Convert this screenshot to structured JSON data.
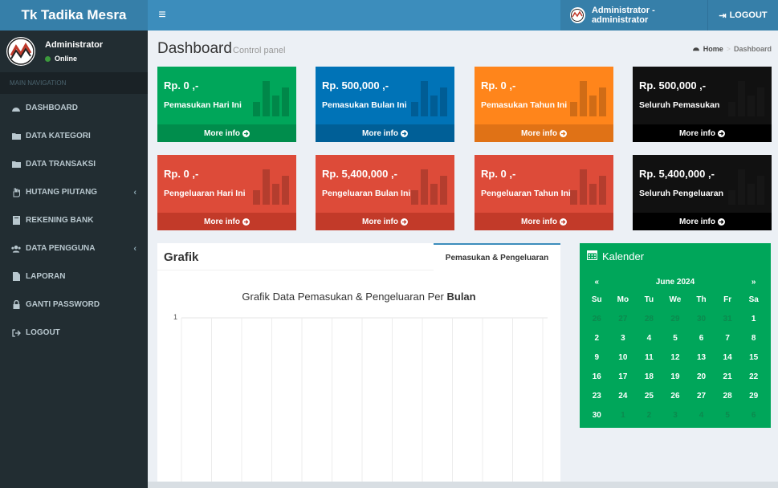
{
  "header": {
    "app_title": "Tk Tadika Mesra",
    "user_label": "Administrator - administrator",
    "logout_label": "LOGOUT"
  },
  "sidebar": {
    "user_name": "Administrator",
    "user_status": "Online",
    "nav_header": "MAIN NAVIGATION",
    "items": [
      {
        "label": "DASHBOARD",
        "icon": "dashboard-icon"
      },
      {
        "label": "DATA KATEGORI",
        "icon": "folder-icon"
      },
      {
        "label": "DATA TRANSAKSI",
        "icon": "folder-icon"
      },
      {
        "label": "HUTANG PIUTANG",
        "icon": "hand-icon"
      },
      {
        "label": "REKENING BANK",
        "icon": "book-icon"
      },
      {
        "label": "DATA PENGGUNA",
        "icon": "users-icon"
      },
      {
        "label": "LAPORAN",
        "icon": "file-icon"
      },
      {
        "label": "GANTI PASSWORD",
        "icon": "lock-icon"
      },
      {
        "label": "LOGOUT",
        "icon": "sign-out-icon"
      }
    ]
  },
  "page": {
    "title": "Dashboard",
    "subtitle": "Control panel",
    "breadcrumb_home": "Home",
    "breadcrumb_current": "Dashboard"
  },
  "boxes": [
    {
      "amount": "Rp. 0 ,-",
      "label": "Pemasukan Hari Ini",
      "more": "More info",
      "color": "#00a65a"
    },
    {
      "amount": "Rp. 500,000 ,-",
      "label": "Pemasukan Bulan Ini",
      "more": "More info",
      "color": "#0073b7"
    },
    {
      "amount": "Rp. 0 ,-",
      "label": "Pemasukan Tahun Ini",
      "more": "More info",
      "color": "#ff851b"
    },
    {
      "amount": "Rp. 500,000 ,-",
      "label": "Seluruh Pemasukan",
      "more": "More info",
      "color": "#111111"
    },
    {
      "amount": "Rp. 0 ,-",
      "label": "Pengeluaran Hari Ini",
      "more": "More info",
      "color": "#dd4b39"
    },
    {
      "amount": "Rp. 5,400,000 ,-",
      "label": "Pengeluaran Bulan Ini",
      "more": "More info",
      "color": "#dd4b39"
    },
    {
      "amount": "Rp. 0 ,-",
      "label": "Pengeluaran Tahun Ini",
      "more": "More info",
      "color": "#dd4b39"
    },
    {
      "amount": "Rp. 5,400,000 ,-",
      "label": "Seluruh Pengeluaran",
      "more": "More info",
      "color": "#111111"
    }
  ],
  "chart_panel": {
    "title": "Grafik",
    "tab_label": "Pemasukan & Pengeluaran",
    "headline_prefix": "Grafik Data Pemasukan & Pengeluaran Per",
    "headline_bold": "Bulan",
    "y_tick_top": "1"
  },
  "calendar": {
    "title": "Kalender",
    "month": "June 2024",
    "prev": "«",
    "next": "»",
    "weekdays": [
      "Su",
      "Mo",
      "Tu",
      "We",
      "Th",
      "Fr",
      "Sa"
    ],
    "weeks": [
      [
        "26",
        "27",
        "28",
        "29",
        "30",
        "31",
        "1"
      ],
      [
        "2",
        "3",
        "4",
        "5",
        "6",
        "7",
        "8"
      ],
      [
        "9",
        "10",
        "11",
        "12",
        "13",
        "14",
        "15"
      ],
      [
        "16",
        "17",
        "18",
        "19",
        "20",
        "21",
        "22"
      ],
      [
        "23",
        "24",
        "25",
        "26",
        "27",
        "28",
        "29"
      ],
      [
        "30",
        "1",
        "2",
        "3",
        "4",
        "5",
        "6"
      ]
    ]
  }
}
